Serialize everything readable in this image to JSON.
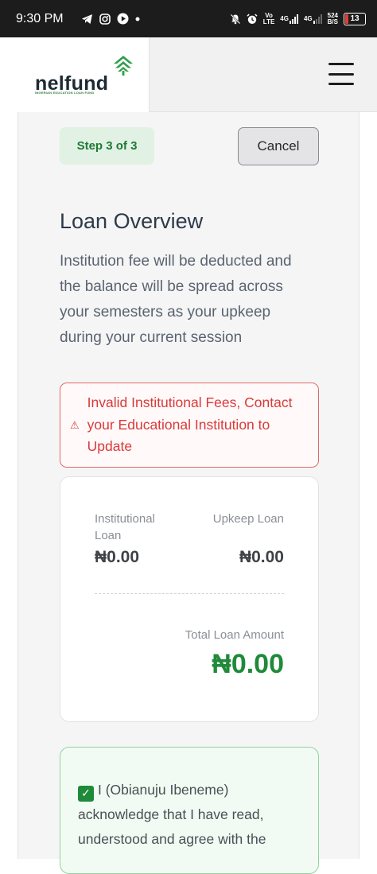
{
  "status_bar": {
    "time": "9:30 PM",
    "left_icons": [
      "telegram-icon",
      "instagram-icon",
      "play-icon",
      "dot-icon"
    ],
    "right_icons": [
      "mute-icon",
      "alarm-icon",
      "volte-icon",
      "signal-4g-icon",
      "signal-4g-icon-2"
    ],
    "volte_text": "Vo\nLTE",
    "net1": "4G",
    "net2": "4G",
    "speed": "524\nB/S",
    "battery_level": "13",
    "battery_color": "#e53935"
  },
  "header": {
    "brand": "nelfund",
    "brand_sub": "NIGERIAN EDUCATION LOAN FUND",
    "menu_icon": "hamburger-menu-icon"
  },
  "step": {
    "label": "Step 3 of 3"
  },
  "cancel_label": "Cancel",
  "overview": {
    "title": "Loan Overview",
    "description": "Institution fee will be deducted and the balance will be spread across your semesters as your upkeep during your current session"
  },
  "alert": {
    "icon": "warning-icon",
    "message": "Invalid Institutional Fees, Contact your Educational Institution to Update"
  },
  "summary": {
    "institutional_label": "Institutional Loan",
    "institutional_value": "₦0.00",
    "upkeep_label": "Upkeep Loan",
    "upkeep_value": "₦0.00",
    "total_label": "Total Loan Amount",
    "total_value": "₦0.00"
  },
  "acknowledgement": {
    "checked": true,
    "text": "I (Obianuju Ibeneme) acknowledge that I have read, understood and agree with the"
  },
  "colors": {
    "accent_green": "#1f8a3a",
    "error_red": "#d93a3a",
    "title_color": "#2d3a48"
  }
}
